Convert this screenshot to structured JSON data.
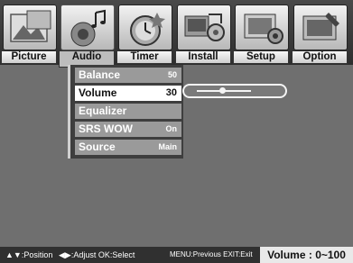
{
  "tabs": [
    {
      "label": "Picture",
      "icon": "picture-icon",
      "active": false
    },
    {
      "label": "Audio",
      "icon": "audio-icon",
      "active": true
    },
    {
      "label": "Timer",
      "icon": "timer-icon",
      "active": false
    },
    {
      "label": "Install",
      "icon": "install-icon",
      "active": false
    },
    {
      "label": "Setup",
      "icon": "setup-icon",
      "active": false
    },
    {
      "label": "Option",
      "icon": "option-icon",
      "active": false
    }
  ],
  "audio_menu": {
    "items": [
      {
        "label": "Balance",
        "value": "50"
      },
      {
        "label": "Volume",
        "value": "30"
      },
      {
        "label": "Equalizer",
        "value": ""
      },
      {
        "label": "SRS WOW",
        "value": "On"
      },
      {
        "label": "Source",
        "value": "Main"
      }
    ],
    "selected_index": 1
  },
  "volume_slider": {
    "value": 30,
    "min": 0,
    "max": 100
  },
  "hints": {
    "position": "▲▼:Position",
    "adjust": "◀▶:Adjust OK:Select",
    "menu": "MENU:Previous EXIT:Exit"
  },
  "range_info": "Volume : 0~100",
  "colors": {
    "background": "#6f6f6f",
    "panel": "#3e3e3e",
    "item": "#9a9a9a",
    "selected": "#ffffff"
  }
}
